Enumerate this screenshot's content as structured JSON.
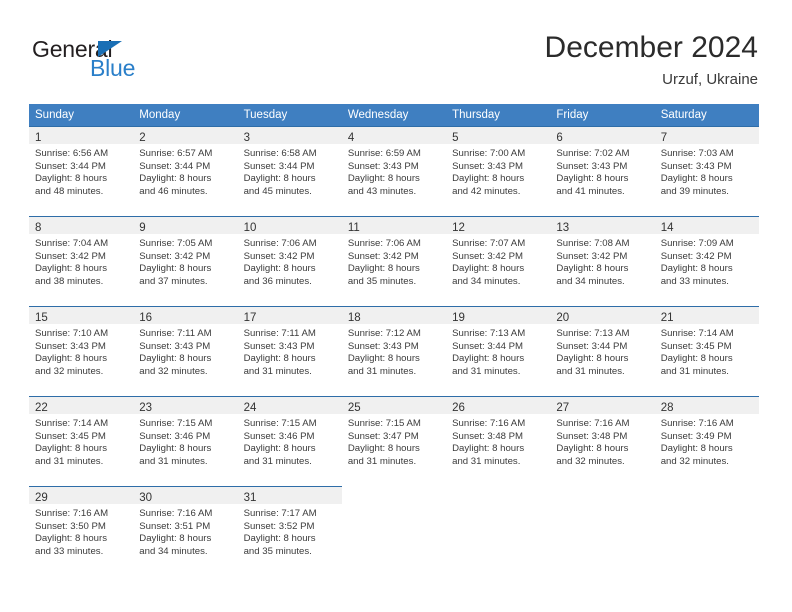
{
  "logo": {
    "text_top": "General",
    "text_bottom": "Blue",
    "color_dark": "#231f20",
    "color_blue": "#2a7fc9"
  },
  "header": {
    "month_title": "December 2024",
    "location": "Urzuf, Ukraine"
  },
  "theme": {
    "header_blue": "#3f7fc1",
    "row_border_blue": "#2e6da8",
    "daynum_band": "#f0f0f0"
  },
  "calendar": {
    "weekday_headers": [
      "Sunday",
      "Monday",
      "Tuesday",
      "Wednesday",
      "Thursday",
      "Friday",
      "Saturday"
    ],
    "weeks": [
      [
        {
          "day": "1",
          "sunrise": "Sunrise: 6:56 AM",
          "sunset": "Sunset: 3:44 PM",
          "daylight_line1": "Daylight: 8 hours",
          "daylight_line2": "and 48 minutes."
        },
        {
          "day": "2",
          "sunrise": "Sunrise: 6:57 AM",
          "sunset": "Sunset: 3:44 PM",
          "daylight_line1": "Daylight: 8 hours",
          "daylight_line2": "and 46 minutes."
        },
        {
          "day": "3",
          "sunrise": "Sunrise: 6:58 AM",
          "sunset": "Sunset: 3:44 PM",
          "daylight_line1": "Daylight: 8 hours",
          "daylight_line2": "and 45 minutes."
        },
        {
          "day": "4",
          "sunrise": "Sunrise: 6:59 AM",
          "sunset": "Sunset: 3:43 PM",
          "daylight_line1": "Daylight: 8 hours",
          "daylight_line2": "and 43 minutes."
        },
        {
          "day": "5",
          "sunrise": "Sunrise: 7:00 AM",
          "sunset": "Sunset: 3:43 PM",
          "daylight_line1": "Daylight: 8 hours",
          "daylight_line2": "and 42 minutes."
        },
        {
          "day": "6",
          "sunrise": "Sunrise: 7:02 AM",
          "sunset": "Sunset: 3:43 PM",
          "daylight_line1": "Daylight: 8 hours",
          "daylight_line2": "and 41 minutes."
        },
        {
          "day": "7",
          "sunrise": "Sunrise: 7:03 AM",
          "sunset": "Sunset: 3:43 PM",
          "daylight_line1": "Daylight: 8 hours",
          "daylight_line2": "and 39 minutes."
        }
      ],
      [
        {
          "day": "8",
          "sunrise": "Sunrise: 7:04 AM",
          "sunset": "Sunset: 3:42 PM",
          "daylight_line1": "Daylight: 8 hours",
          "daylight_line2": "and 38 minutes."
        },
        {
          "day": "9",
          "sunrise": "Sunrise: 7:05 AM",
          "sunset": "Sunset: 3:42 PM",
          "daylight_line1": "Daylight: 8 hours",
          "daylight_line2": "and 37 minutes."
        },
        {
          "day": "10",
          "sunrise": "Sunrise: 7:06 AM",
          "sunset": "Sunset: 3:42 PM",
          "daylight_line1": "Daylight: 8 hours",
          "daylight_line2": "and 36 minutes."
        },
        {
          "day": "11",
          "sunrise": "Sunrise: 7:06 AM",
          "sunset": "Sunset: 3:42 PM",
          "daylight_line1": "Daylight: 8 hours",
          "daylight_line2": "and 35 minutes."
        },
        {
          "day": "12",
          "sunrise": "Sunrise: 7:07 AM",
          "sunset": "Sunset: 3:42 PM",
          "daylight_line1": "Daylight: 8 hours",
          "daylight_line2": "and 34 minutes."
        },
        {
          "day": "13",
          "sunrise": "Sunrise: 7:08 AM",
          "sunset": "Sunset: 3:42 PM",
          "daylight_line1": "Daylight: 8 hours",
          "daylight_line2": "and 34 minutes."
        },
        {
          "day": "14",
          "sunrise": "Sunrise: 7:09 AM",
          "sunset": "Sunset: 3:42 PM",
          "daylight_line1": "Daylight: 8 hours",
          "daylight_line2": "and 33 minutes."
        }
      ],
      [
        {
          "day": "15",
          "sunrise": "Sunrise: 7:10 AM",
          "sunset": "Sunset: 3:43 PM",
          "daylight_line1": "Daylight: 8 hours",
          "daylight_line2": "and 32 minutes."
        },
        {
          "day": "16",
          "sunrise": "Sunrise: 7:11 AM",
          "sunset": "Sunset: 3:43 PM",
          "daylight_line1": "Daylight: 8 hours",
          "daylight_line2": "and 32 minutes."
        },
        {
          "day": "17",
          "sunrise": "Sunrise: 7:11 AM",
          "sunset": "Sunset: 3:43 PM",
          "daylight_line1": "Daylight: 8 hours",
          "daylight_line2": "and 31 minutes."
        },
        {
          "day": "18",
          "sunrise": "Sunrise: 7:12 AM",
          "sunset": "Sunset: 3:43 PM",
          "daylight_line1": "Daylight: 8 hours",
          "daylight_line2": "and 31 minutes."
        },
        {
          "day": "19",
          "sunrise": "Sunrise: 7:13 AM",
          "sunset": "Sunset: 3:44 PM",
          "daylight_line1": "Daylight: 8 hours",
          "daylight_line2": "and 31 minutes."
        },
        {
          "day": "20",
          "sunrise": "Sunrise: 7:13 AM",
          "sunset": "Sunset: 3:44 PM",
          "daylight_line1": "Daylight: 8 hours",
          "daylight_line2": "and 31 minutes."
        },
        {
          "day": "21",
          "sunrise": "Sunrise: 7:14 AM",
          "sunset": "Sunset: 3:45 PM",
          "daylight_line1": "Daylight: 8 hours",
          "daylight_line2": "and 31 minutes."
        }
      ],
      [
        {
          "day": "22",
          "sunrise": "Sunrise: 7:14 AM",
          "sunset": "Sunset: 3:45 PM",
          "daylight_line1": "Daylight: 8 hours",
          "daylight_line2": "and 31 minutes."
        },
        {
          "day": "23",
          "sunrise": "Sunrise: 7:15 AM",
          "sunset": "Sunset: 3:46 PM",
          "daylight_line1": "Daylight: 8 hours",
          "daylight_line2": "and 31 minutes."
        },
        {
          "day": "24",
          "sunrise": "Sunrise: 7:15 AM",
          "sunset": "Sunset: 3:46 PM",
          "daylight_line1": "Daylight: 8 hours",
          "daylight_line2": "and 31 minutes."
        },
        {
          "day": "25",
          "sunrise": "Sunrise: 7:15 AM",
          "sunset": "Sunset: 3:47 PM",
          "daylight_line1": "Daylight: 8 hours",
          "daylight_line2": "and 31 minutes."
        },
        {
          "day": "26",
          "sunrise": "Sunrise: 7:16 AM",
          "sunset": "Sunset: 3:48 PM",
          "daylight_line1": "Daylight: 8 hours",
          "daylight_line2": "and 31 minutes."
        },
        {
          "day": "27",
          "sunrise": "Sunrise: 7:16 AM",
          "sunset": "Sunset: 3:48 PM",
          "daylight_line1": "Daylight: 8 hours",
          "daylight_line2": "and 32 minutes."
        },
        {
          "day": "28",
          "sunrise": "Sunrise: 7:16 AM",
          "sunset": "Sunset: 3:49 PM",
          "daylight_line1": "Daylight: 8 hours",
          "daylight_line2": "and 32 minutes."
        }
      ],
      [
        {
          "day": "29",
          "sunrise": "Sunrise: 7:16 AM",
          "sunset": "Sunset: 3:50 PM",
          "daylight_line1": "Daylight: 8 hours",
          "daylight_line2": "and 33 minutes."
        },
        {
          "day": "30",
          "sunrise": "Sunrise: 7:16 AM",
          "sunset": "Sunset: 3:51 PM",
          "daylight_line1": "Daylight: 8 hours",
          "daylight_line2": "and 34 minutes."
        },
        {
          "day": "31",
          "sunrise": "Sunrise: 7:17 AM",
          "sunset": "Sunset: 3:52 PM",
          "daylight_line1": "Daylight: 8 hours",
          "daylight_line2": "and 35 minutes."
        },
        {
          "day": "",
          "sunrise": "",
          "sunset": "",
          "daylight_line1": "",
          "daylight_line2": ""
        },
        {
          "day": "",
          "sunrise": "",
          "sunset": "",
          "daylight_line1": "",
          "daylight_line2": ""
        },
        {
          "day": "",
          "sunrise": "",
          "sunset": "",
          "daylight_line1": "",
          "daylight_line2": ""
        },
        {
          "day": "",
          "sunrise": "",
          "sunset": "",
          "daylight_line1": "",
          "daylight_line2": ""
        }
      ]
    ]
  }
}
